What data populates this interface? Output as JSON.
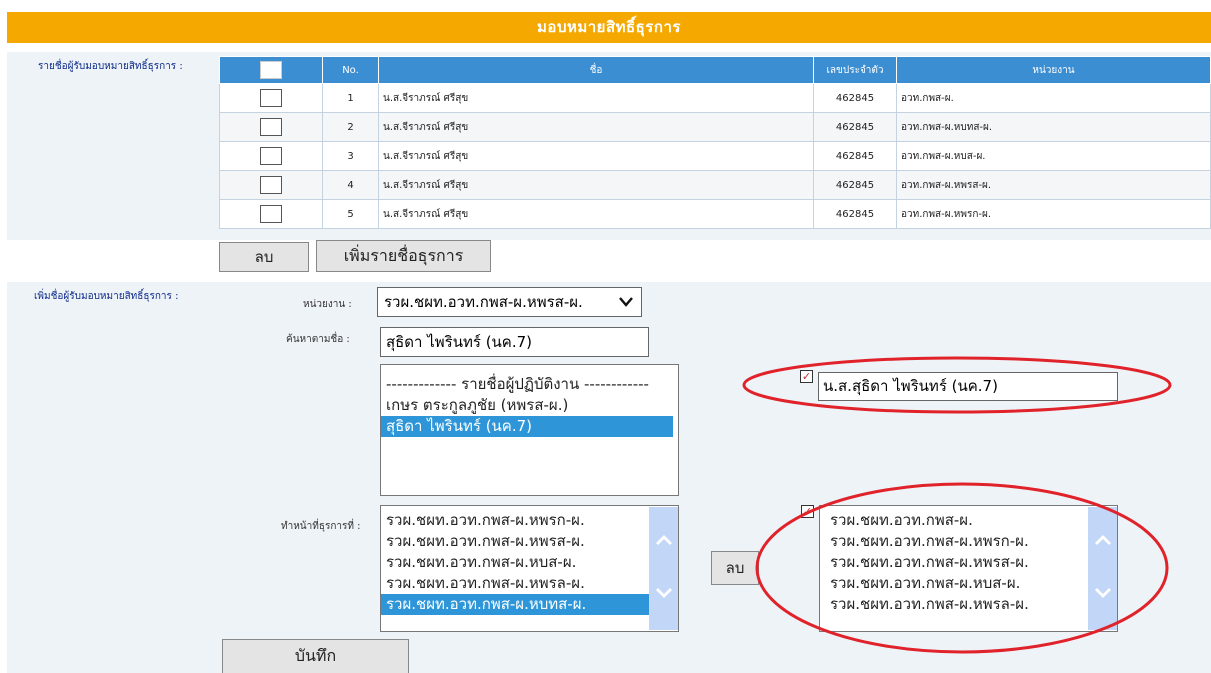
{
  "title": "มอบหมายสิทธิ์ธุรการ",
  "recipients": {
    "label": "รายชื่อผู้รับมอบหมายสิทธิ์ธุรการ :",
    "columns": {
      "no": "No.",
      "name": "ชื่อ",
      "id": "เลขประจำตัว",
      "unit": "หน่วยงาน"
    },
    "rows": [
      {
        "no": "1",
        "name": "น.ส.จีราภรณ์ ศรีสุข",
        "id": "462845",
        "unit": "อวท.กพส-ผ."
      },
      {
        "no": "2",
        "name": "น.ส.จีราภรณ์ ศรีสุข",
        "id": "462845",
        "unit": "อวท.กพส-ผ.หบทส-ผ."
      },
      {
        "no": "3",
        "name": "น.ส.จีราภรณ์ ศรีสุข",
        "id": "462845",
        "unit": "อวท.กพส-ผ.หบส-ผ."
      },
      {
        "no": "4",
        "name": "น.ส.จีราภรณ์ ศรีสุข",
        "id": "462845",
        "unit": "อวท.กพส-ผ.หพรส-ผ."
      },
      {
        "no": "5",
        "name": "น.ส.จีราภรณ์ ศรีสุข",
        "id": "462845",
        "unit": "อวท.กพส-ผ.หพรก-ผ."
      }
    ],
    "delete_label": "ลบ",
    "add_label": "เพิ่มรายชื่อธุรการ"
  },
  "add_form": {
    "label": "เพิ่มชื่อผู้รับมอบหมายสิทธิ์ธุรการ :",
    "unit_label": "หน่วยงาน :",
    "unit_value": "รวผ.ชผท.อวท.กพส-ผ.หพรส-ผ.",
    "search_label": "ค้นหาตามชื่อ :",
    "search_value": "สุธิดา ไพรินทร์ (นค.7)",
    "staff_list": [
      "------------- รายชื่อผู้ปฏิบัติงาน ------------",
      "เกษร ตระกูลภูชัย (หพรส-ผ.)",
      "สุธิดา ไพรินทร์ (นค.7)"
    ],
    "selected_name": "น.ส.สุธิดา ไพรินทร์ (นค.7)",
    "duty_label": "ทำหน้าที่ธุรการที่ :",
    "duty_options": [
      "รวผ.ชผท.อวท.กพส-ผ.หพรก-ผ.",
      "รวผ.ชผท.อวท.กพส-ผ.หพรส-ผ.",
      "รวผ.ชผท.อวท.กพส-ผ.หบส-ผ.",
      "รวผ.ชผท.อวท.กพส-ผ.หพรล-ผ.",
      "รวผ.ชผท.อวท.กพส-ผ.หบทส-ผ."
    ],
    "assigned_units": [
      "รวผ.ชผท.อวท.กพส-ผ.",
      "รวผ.ชผท.อวท.กพส-ผ.หพรก-ผ.",
      "รวผ.ชผท.อวท.กพส-ผ.หพรส-ผ.",
      "รวผ.ชผท.อวท.กพส-ผ.หบส-ผ.",
      "รวผ.ชผท.อวท.กพส-ผ.หพรล-ผ."
    ],
    "remove_label": "ลบ",
    "save_label": "บันทึก"
  },
  "colors": {
    "header": "#f4a800",
    "table_head": "#3b8ed2",
    "selection": "#2e96d8",
    "annotation": "#e0232a"
  },
  "icons": {
    "scroll_up": "chevron-up-icon",
    "scroll_down": "chevron-down-icon",
    "dropdown": "chevron-down-icon",
    "checked": "checkmark-icon"
  }
}
